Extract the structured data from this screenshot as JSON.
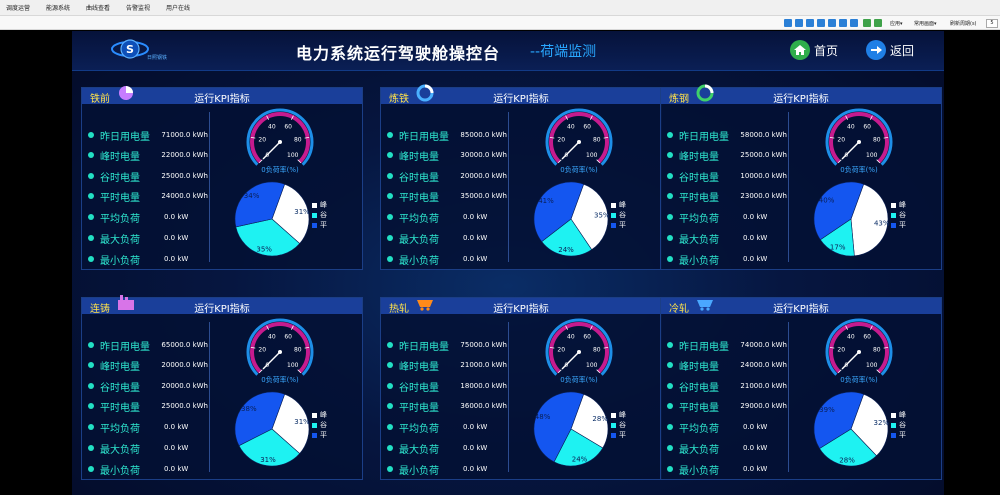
{
  "menu": [
    "调度运营",
    "能源系统",
    "曲线查看",
    "告警监视",
    "用户在线"
  ],
  "toolbar": {
    "apply_label": "应用▾",
    "common_label": "常用画面▾",
    "refresh_label": "刷新周期(s)",
    "refresh_value": "5"
  },
  "header": {
    "logo_text": "日照钢铁",
    "title": "电力系统运行驾驶舱操控台",
    "subtitle": "--荷端监测",
    "home_label": "首页",
    "back_label": "返回"
  },
  "colors": {
    "accent": "#29a7ff",
    "panel_name": "#ffe24a",
    "kpi_label": "#2ee8d0",
    "pie_peak": "#ffffff",
    "pie_valley": "#1ef2f2",
    "pie_flat": "#1456f0"
  },
  "kpi_title": "运行KPI指标",
  "kpi_labels": [
    "昨日用电量",
    "峰时电量",
    "谷时电量",
    "平时电量",
    "平均负荷",
    "最大负荷",
    "最小负荷"
  ],
  "gauge": {
    "caption": "0负荷率(%)",
    "ticks": [
      "0",
      "20",
      "40",
      "60",
      "80",
      "100"
    ],
    "value": 0,
    "range": [
      0,
      100
    ]
  },
  "legend": [
    "峰",
    "谷",
    "平"
  ],
  "panels": [
    {
      "name": "铁前",
      "icon": "pie-chart-icon",
      "values": [
        "71000.0 kWh",
        "22000.0 kWh",
        "25000.0 kWh",
        "24000.0 kWh",
        "0.0 kW",
        "0.0 kW",
        "0.0 kW"
      ],
      "pie": [
        31,
        35,
        34
      ]
    },
    {
      "name": "炼铁",
      "icon": "ring-chart-icon",
      "values": [
        "85000.0 kWh",
        "30000.0 kWh",
        "20000.0 kWh",
        "35000.0 kWh",
        "0.0 kW",
        "0.0 kW",
        "0.0 kW"
      ],
      "pie": [
        35,
        24,
        41
      ]
    },
    {
      "name": "炼钢",
      "icon": "green-ring-icon",
      "values": [
        "58000.0 kWh",
        "25000.0 kWh",
        "10000.0 kWh",
        "23000.0 kWh",
        "0.0 kW",
        "0.0 kW",
        "0.0 kW"
      ],
      "pie": [
        43,
        17,
        40
      ]
    },
    {
      "name": "连铸",
      "icon": "factory-icon",
      "values": [
        "65000.0 kWh",
        "20000.0 kWh",
        "20000.0 kWh",
        "25000.0 kWh",
        "0.0 kW",
        "0.0 kW",
        "0.0 kW"
      ],
      "pie": [
        31,
        31,
        38
      ]
    },
    {
      "name": "热轧",
      "icon": "mine-cart-icon",
      "values": [
        "75000.0 kWh",
        "21000.0 kWh",
        "18000.0 kWh",
        "36000.0 kWh",
        "0.0 kW",
        "0.0 kW",
        "0.0 kW"
      ],
      "pie": [
        28,
        24,
        48
      ]
    },
    {
      "name": "冷轧",
      "icon": "cart-icon",
      "values": [
        "74000.0 kWh",
        "24000.0 kWh",
        "21000.0 kWh",
        "29000.0 kWh",
        "0.0 kW",
        "0.0 kW",
        "0.0 kW"
      ],
      "pie": [
        32,
        28,
        39
      ]
    }
  ]
}
